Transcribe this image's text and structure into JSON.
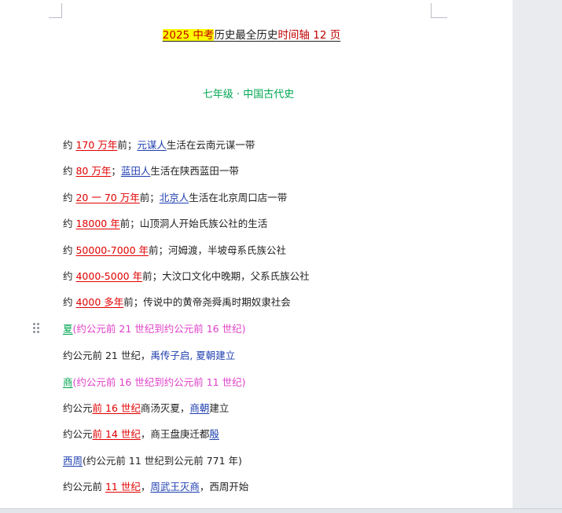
{
  "title": {
    "part1": "2025 中考",
    "part2": "历史最全历史",
    "part3": "时间轴 12 页"
  },
  "section_heading": "七年级 · 中国古代史",
  "lines": [
    {
      "prefix": "约 ",
      "date": "170 万年",
      "mid": "前；",
      "name": "元谋人",
      "rest": "生活在云南元谋一带"
    },
    {
      "prefix": "约 ",
      "date": "80 万年",
      "mid": "；",
      "name": "蓝田人",
      "rest": "生活在陕西蓝田一带"
    },
    {
      "prefix": "约 ",
      "date": "20 一 70 万年",
      "mid": "前；",
      "name": "北京人",
      "rest": "生活在北京周口店一带"
    },
    {
      "prefix": "约 ",
      "date": "18000 年",
      "mid": "前；山顶洞人开始氏族公社的生活"
    },
    {
      "prefix": "约 ",
      "date": "50000-7000 年",
      "mid": "前；河姆渡，半坡母系氏族公社"
    },
    {
      "prefix": "约 ",
      "date": "4000-5000 年",
      "mid": "前；大汶口文化中晚期，父系氏族公社"
    },
    {
      "prefix": "约 ",
      "date": "4000 多年",
      "mid": "前；传说中的黄帝尧舜禹时期奴隶社会"
    }
  ],
  "xia": {
    "name": "夏",
    "range": "(约公元前 21 世纪到约公元前 16 世纪)"
  },
  "xia_line": {
    "prefix": "约公元前 21 世纪，",
    "event": "禹传子启, 夏朝建立"
  },
  "shang": {
    "name": "商",
    "range": "(约公元前 16 世纪到约公元前 11 世纪)"
  },
  "shang_line1": {
    "prefix": "约公元",
    "date": "前 16 世纪",
    "mid": "商汤灭夏，",
    "name": "商朝",
    "rest": "建立"
  },
  "shang_line2": {
    "prefix": "约公元",
    "date": "前 14 世纪",
    "mid": "，商王盘庚迁都",
    "name": "殷"
  },
  "xizhou": {
    "name": "西周",
    "range": "(约公元前 11 世纪到公元前 771 年)"
  },
  "xizhou_line": {
    "prefix": "约公元前 ",
    "date": "11 世纪",
    "mid": "，",
    "name": "周武王灭商",
    "rest": "，西周开始"
  }
}
